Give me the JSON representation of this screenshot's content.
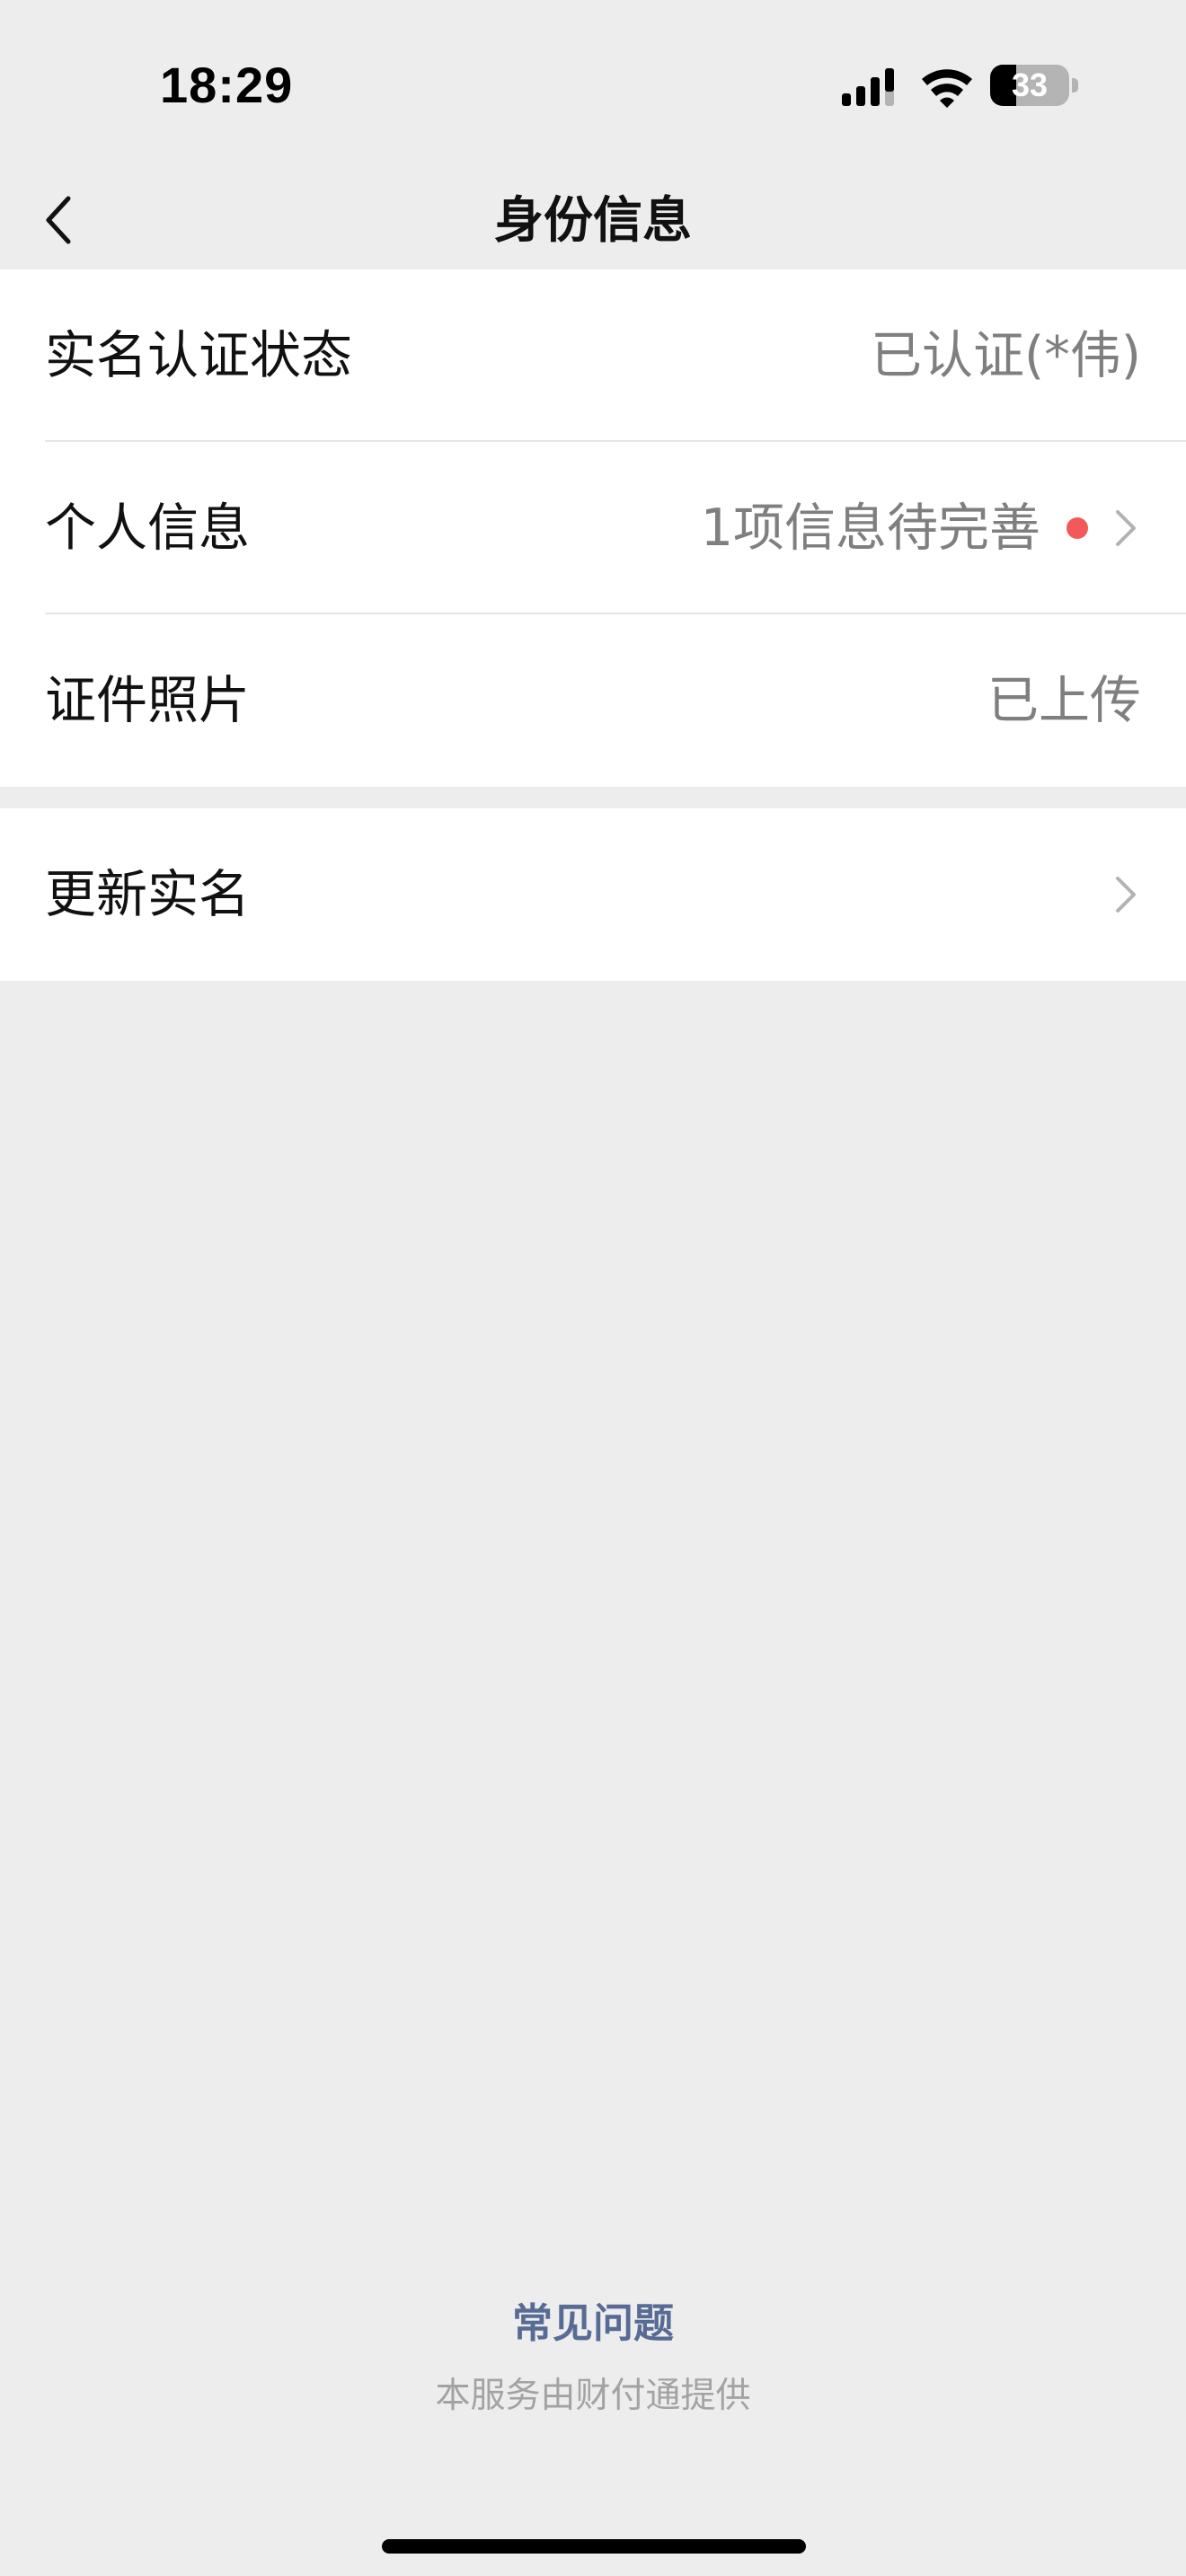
{
  "status_bar": {
    "time": "18:29",
    "battery_level": "33",
    "icons": [
      "signal-icon",
      "wifi-icon",
      "battery-icon"
    ]
  },
  "nav": {
    "title": "身份信息",
    "back_icon": "chevron-left-icon"
  },
  "identity_rows": [
    {
      "label": "实名认证状态",
      "value": "已认证(*伟)",
      "has_arrow": false,
      "has_dot": false
    },
    {
      "label": "个人信息",
      "value": "1项信息待完善",
      "has_arrow": true,
      "has_dot": true
    },
    {
      "label": "证件照片",
      "value": "已上传",
      "has_arrow": false,
      "has_dot": false
    }
  ],
  "update_row": {
    "label": "更新实名",
    "has_arrow": true
  },
  "footer": {
    "faq_label": "常见问题",
    "provider_note": "本服务由财付通提供"
  },
  "colors": {
    "background": "#ededed",
    "card": "#ffffff",
    "link": "#576b95",
    "secondary_text": "#7f7f7f",
    "badge_dot": "#f25a5a"
  }
}
